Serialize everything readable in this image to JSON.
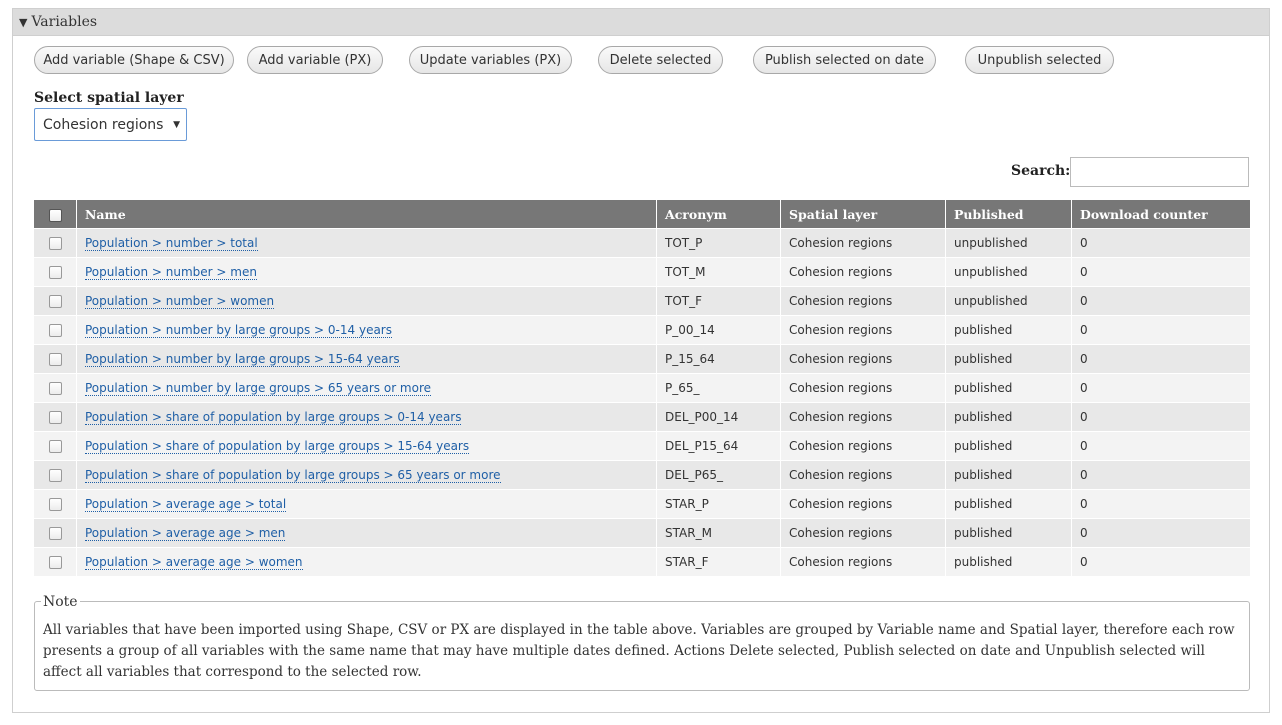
{
  "panel": {
    "title": "Variables"
  },
  "buttons": [
    "Add variable (Shape & CSV)",
    "Add variable (PX)",
    "Update variables (PX)",
    "Delete selected",
    "Publish selected on date",
    "Unpublish selected"
  ],
  "spatial_layer": {
    "label": "Select spatial layer",
    "selected": "Cohesion regions"
  },
  "search": {
    "label": "Search:",
    "value": ""
  },
  "table": {
    "headers": [
      "Name",
      "Acronym",
      "Spatial layer",
      "Published",
      "Download counter"
    ],
    "rows": [
      {
        "name": "Population > number > total",
        "acronym": "TOT_P",
        "layer": "Cohesion regions",
        "published": "unpublished",
        "downloads": "0"
      },
      {
        "name": "Population > number > men",
        "acronym": "TOT_M",
        "layer": "Cohesion regions",
        "published": "unpublished",
        "downloads": "0"
      },
      {
        "name": "Population > number > women",
        "acronym": "TOT_F",
        "layer": "Cohesion regions",
        "published": "unpublished",
        "downloads": "0"
      },
      {
        "name": "Population > number by large groups > 0-14 years",
        "acronym": "P_00_14",
        "layer": "Cohesion regions",
        "published": "published",
        "downloads": "0"
      },
      {
        "name": "Population > number by large groups > 15-64 years",
        "acronym": "P_15_64",
        "layer": "Cohesion regions",
        "published": "published",
        "downloads": "0"
      },
      {
        "name": "Population > number by large groups > 65 years or more",
        "acronym": "P_65_",
        "layer": "Cohesion regions",
        "published": "published",
        "downloads": "0"
      },
      {
        "name": "Population > share of population by large groups > 0-14 years",
        "acronym": "DEL_P00_14",
        "layer": "Cohesion regions",
        "published": "published",
        "downloads": "0"
      },
      {
        "name": "Population > share of population by large groups > 15-64 years",
        "acronym": "DEL_P15_64",
        "layer": "Cohesion regions",
        "published": "published",
        "downloads": "0"
      },
      {
        "name": "Population > share of population by large groups > 65 years or more",
        "acronym": "DEL_P65_",
        "layer": "Cohesion regions",
        "published": "published",
        "downloads": "0"
      },
      {
        "name": "Population > average age > total",
        "acronym": "STAR_P",
        "layer": "Cohesion regions",
        "published": "published",
        "downloads": "0"
      },
      {
        "name": "Population > average age > men",
        "acronym": "STAR_M",
        "layer": "Cohesion regions",
        "published": "published",
        "downloads": "0"
      },
      {
        "name": "Population > average age > women",
        "acronym": "STAR_F",
        "layer": "Cohesion regions",
        "published": "published",
        "downloads": "0"
      }
    ]
  },
  "note": {
    "legend": "Note",
    "text": "All variables that have been imported using Shape, CSV or PX are displayed in the table above. Variables are grouped by Variable name and Spatial layer, therefore each row presents a group of all variables with the same name that may have multiple dates defined. Actions Delete selected, Publish selected on date and Unpublish selected will affect all variables that correspond to the selected row."
  }
}
